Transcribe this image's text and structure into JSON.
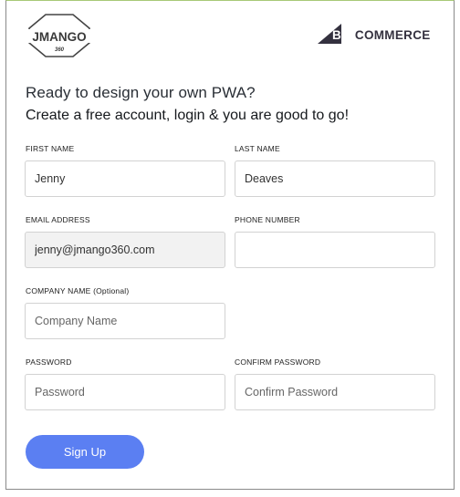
{
  "brand": {
    "jmango_logo_text": "JMANGO",
    "jmango_logo_sub": "360",
    "bigcommerce_logo_text": "BIGCOMMERCE",
    "bigcommerce_colors": {
      "dark": "#34313f",
      "text": "#34313f"
    },
    "jmango_colors": {
      "mark": "#444444"
    }
  },
  "form": {
    "heading": "Ready to design your own PWA?",
    "subheading": "Create a free account, login & you are good to go!",
    "fields": {
      "first_name": {
        "label": "FIRST NAME",
        "value": "Jenny",
        "placeholder": ""
      },
      "last_name": {
        "label": "LAST NAME",
        "value": "Deaves",
        "placeholder": ""
      },
      "email": {
        "label": "EMAIL ADDRESS",
        "value": "jenny@jmango360.com",
        "placeholder": ""
      },
      "phone": {
        "label": "PHONE NUMBER",
        "value": "",
        "placeholder": ""
      },
      "company": {
        "label": "COMPANY NAME (Optional)",
        "value": "",
        "placeholder": "Company Name"
      },
      "password": {
        "label": "PASSWORD",
        "value": "",
        "placeholder": "Password"
      },
      "confirm_password": {
        "label": "CONFIRM PASSWORD",
        "value": "",
        "placeholder": "Confirm Password"
      }
    },
    "submit_label": "Sign Up",
    "accent_color": "#5b7ff2"
  }
}
